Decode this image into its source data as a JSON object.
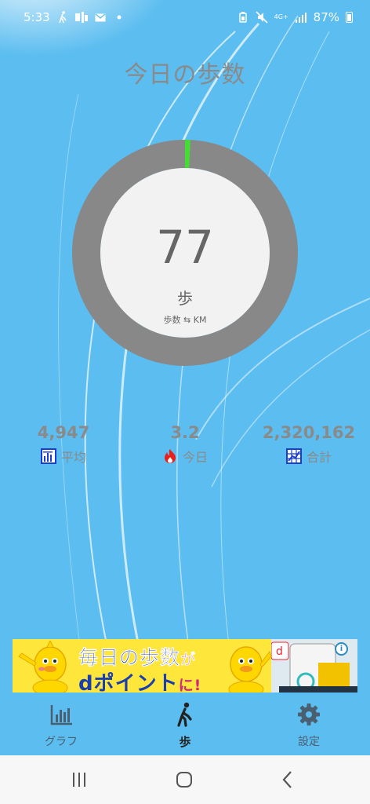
{
  "status_bar": {
    "time": "5:33",
    "battery_percent": "87%",
    "network": "4G+"
  },
  "page": {
    "title": "今日の歩数"
  },
  "ring": {
    "value": "77",
    "unit": "歩",
    "toggle_label": "歩数 ⇆ KM",
    "progress_fraction": 0.0154,
    "track_color": "#888888",
    "progress_color": "#44dd33",
    "center_color": "#f2f2f2"
  },
  "stats": {
    "average": {
      "value": "4,947",
      "label": "平均",
      "icon": "bar-chart-icon"
    },
    "today": {
      "value": "3.2",
      "label": "今日",
      "icon": "fire-icon"
    },
    "total": {
      "value": "2,320,162",
      "label": "合計",
      "icon": "grid-chart-icon"
    }
  },
  "ad": {
    "line1_main": "毎日の歩数",
    "line1_suffix": "が",
    "line2_main": "dポイント",
    "line2_suffix": "に!",
    "info": "i"
  },
  "nav": {
    "items": [
      {
        "label": "グラフ",
        "icon": "bar-graph-icon",
        "active": false
      },
      {
        "label": "歩",
        "icon": "walking-icon",
        "active": true
      },
      {
        "label": "設定",
        "icon": "gear-icon",
        "active": false
      }
    ]
  },
  "colors": {
    "background": "#5bbdf0",
    "accent_blue": "#1a3fb0"
  }
}
